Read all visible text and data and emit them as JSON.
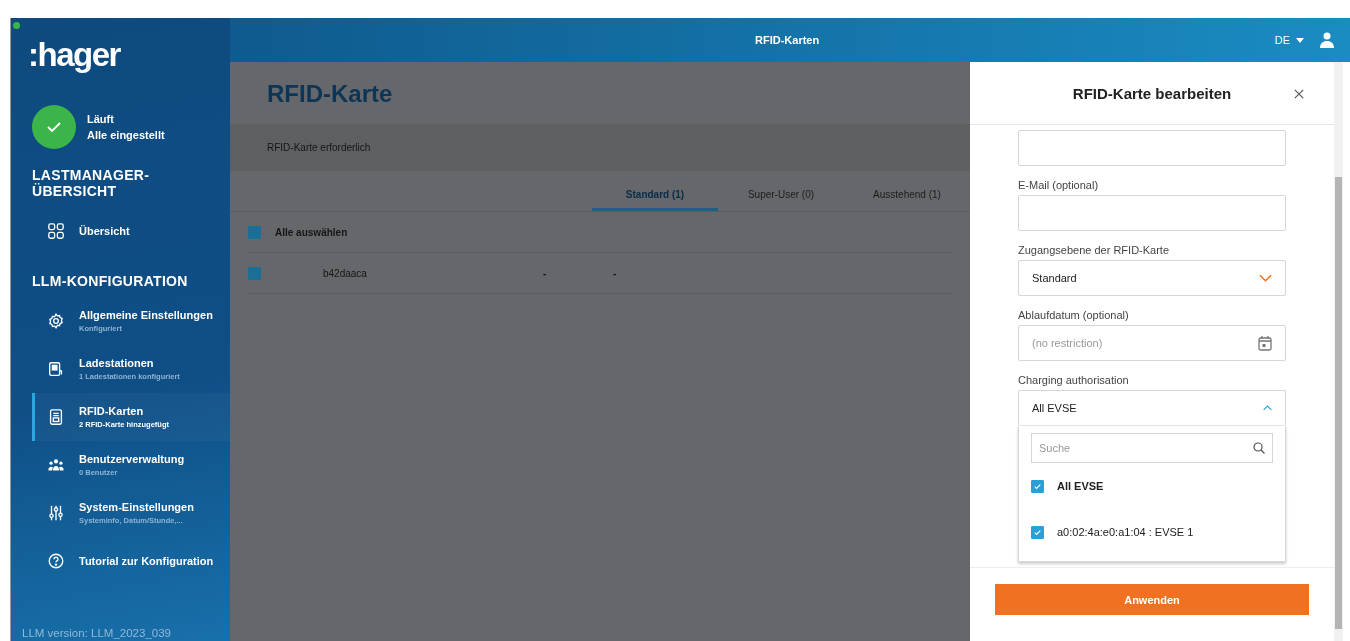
{
  "brand": {
    "logo": ":hager"
  },
  "status": {
    "title": "Läuft",
    "subtitle": "Alle eingestellt",
    "ok": true
  },
  "sidebar": {
    "sections": [
      {
        "heading": "LASTMANAGER-ÜBERSICHT",
        "items": [
          {
            "label": "Übersicht",
            "selected": false
          }
        ]
      },
      {
        "heading": "LLM-KONFIGURATION",
        "items": [
          {
            "label": "Allgemeine Einstellungen",
            "subtitle": "Konfiguriert",
            "selected": false
          },
          {
            "label": "Ladestationen",
            "subtitle": "1 Ladestationen konfiguriert",
            "selected": false
          },
          {
            "label": "RFID-Karten",
            "subtitle": "2 RFID-Karte hinzugefügt",
            "selected": true
          },
          {
            "label": "Benutzerverwaltung",
            "subtitle": "0 Benutzer",
            "selected": false
          },
          {
            "label": "System-Einstellungen",
            "subtitle": "Systeminfo, Datum/Stunde,...",
            "selected": false
          },
          {
            "label": "Tutorial zur Konfiguration",
            "selected": false
          }
        ]
      }
    ],
    "version": "LLM version: LLM_2023_039"
  },
  "header": {
    "title": "RFID-Karten",
    "language": "DE"
  },
  "page": {
    "title": "RFID-Karte",
    "notice": "RFID-Karte erforderlich",
    "tabs": [
      {
        "label": "Standard (1)",
        "selected": true
      },
      {
        "label": "Super-User (0)",
        "selected": false
      },
      {
        "label": "Ausstehend (1)",
        "selected": false
      }
    ],
    "select_all": {
      "label": "Alle auswählen",
      "checked": true
    },
    "rows": [
      {
        "checked": true,
        "column_1": "b42daaca",
        "column_2": "-",
        "column_3": "-"
      }
    ]
  },
  "drawer": {
    "title": "RFID-Karte bearbeiten",
    "fields": [
      {
        "kind": "text"
      },
      {
        "kind": "text",
        "label": "E-Mail (optional)"
      },
      {
        "kind": "select",
        "label": "Zugangsebene der RFID-Karte",
        "value": "Standard",
        "expanded": false
      },
      {
        "kind": "date",
        "label": "Ablaufdatum (optional)",
        "placeholder": "(no restriction)"
      },
      {
        "kind": "multiselect",
        "label": "Charging authorisation",
        "value": "All EVSE",
        "expanded": true,
        "search_placeholder": "Suche",
        "options": [
          {
            "kind": "all",
            "label": "All EVSE",
            "checked": true
          },
          {
            "kind": "item",
            "label": "a0:02:4a:e0:a1:04 : EVSE 1",
            "checked": true
          }
        ]
      }
    ],
    "button": "Anwenden"
  }
}
